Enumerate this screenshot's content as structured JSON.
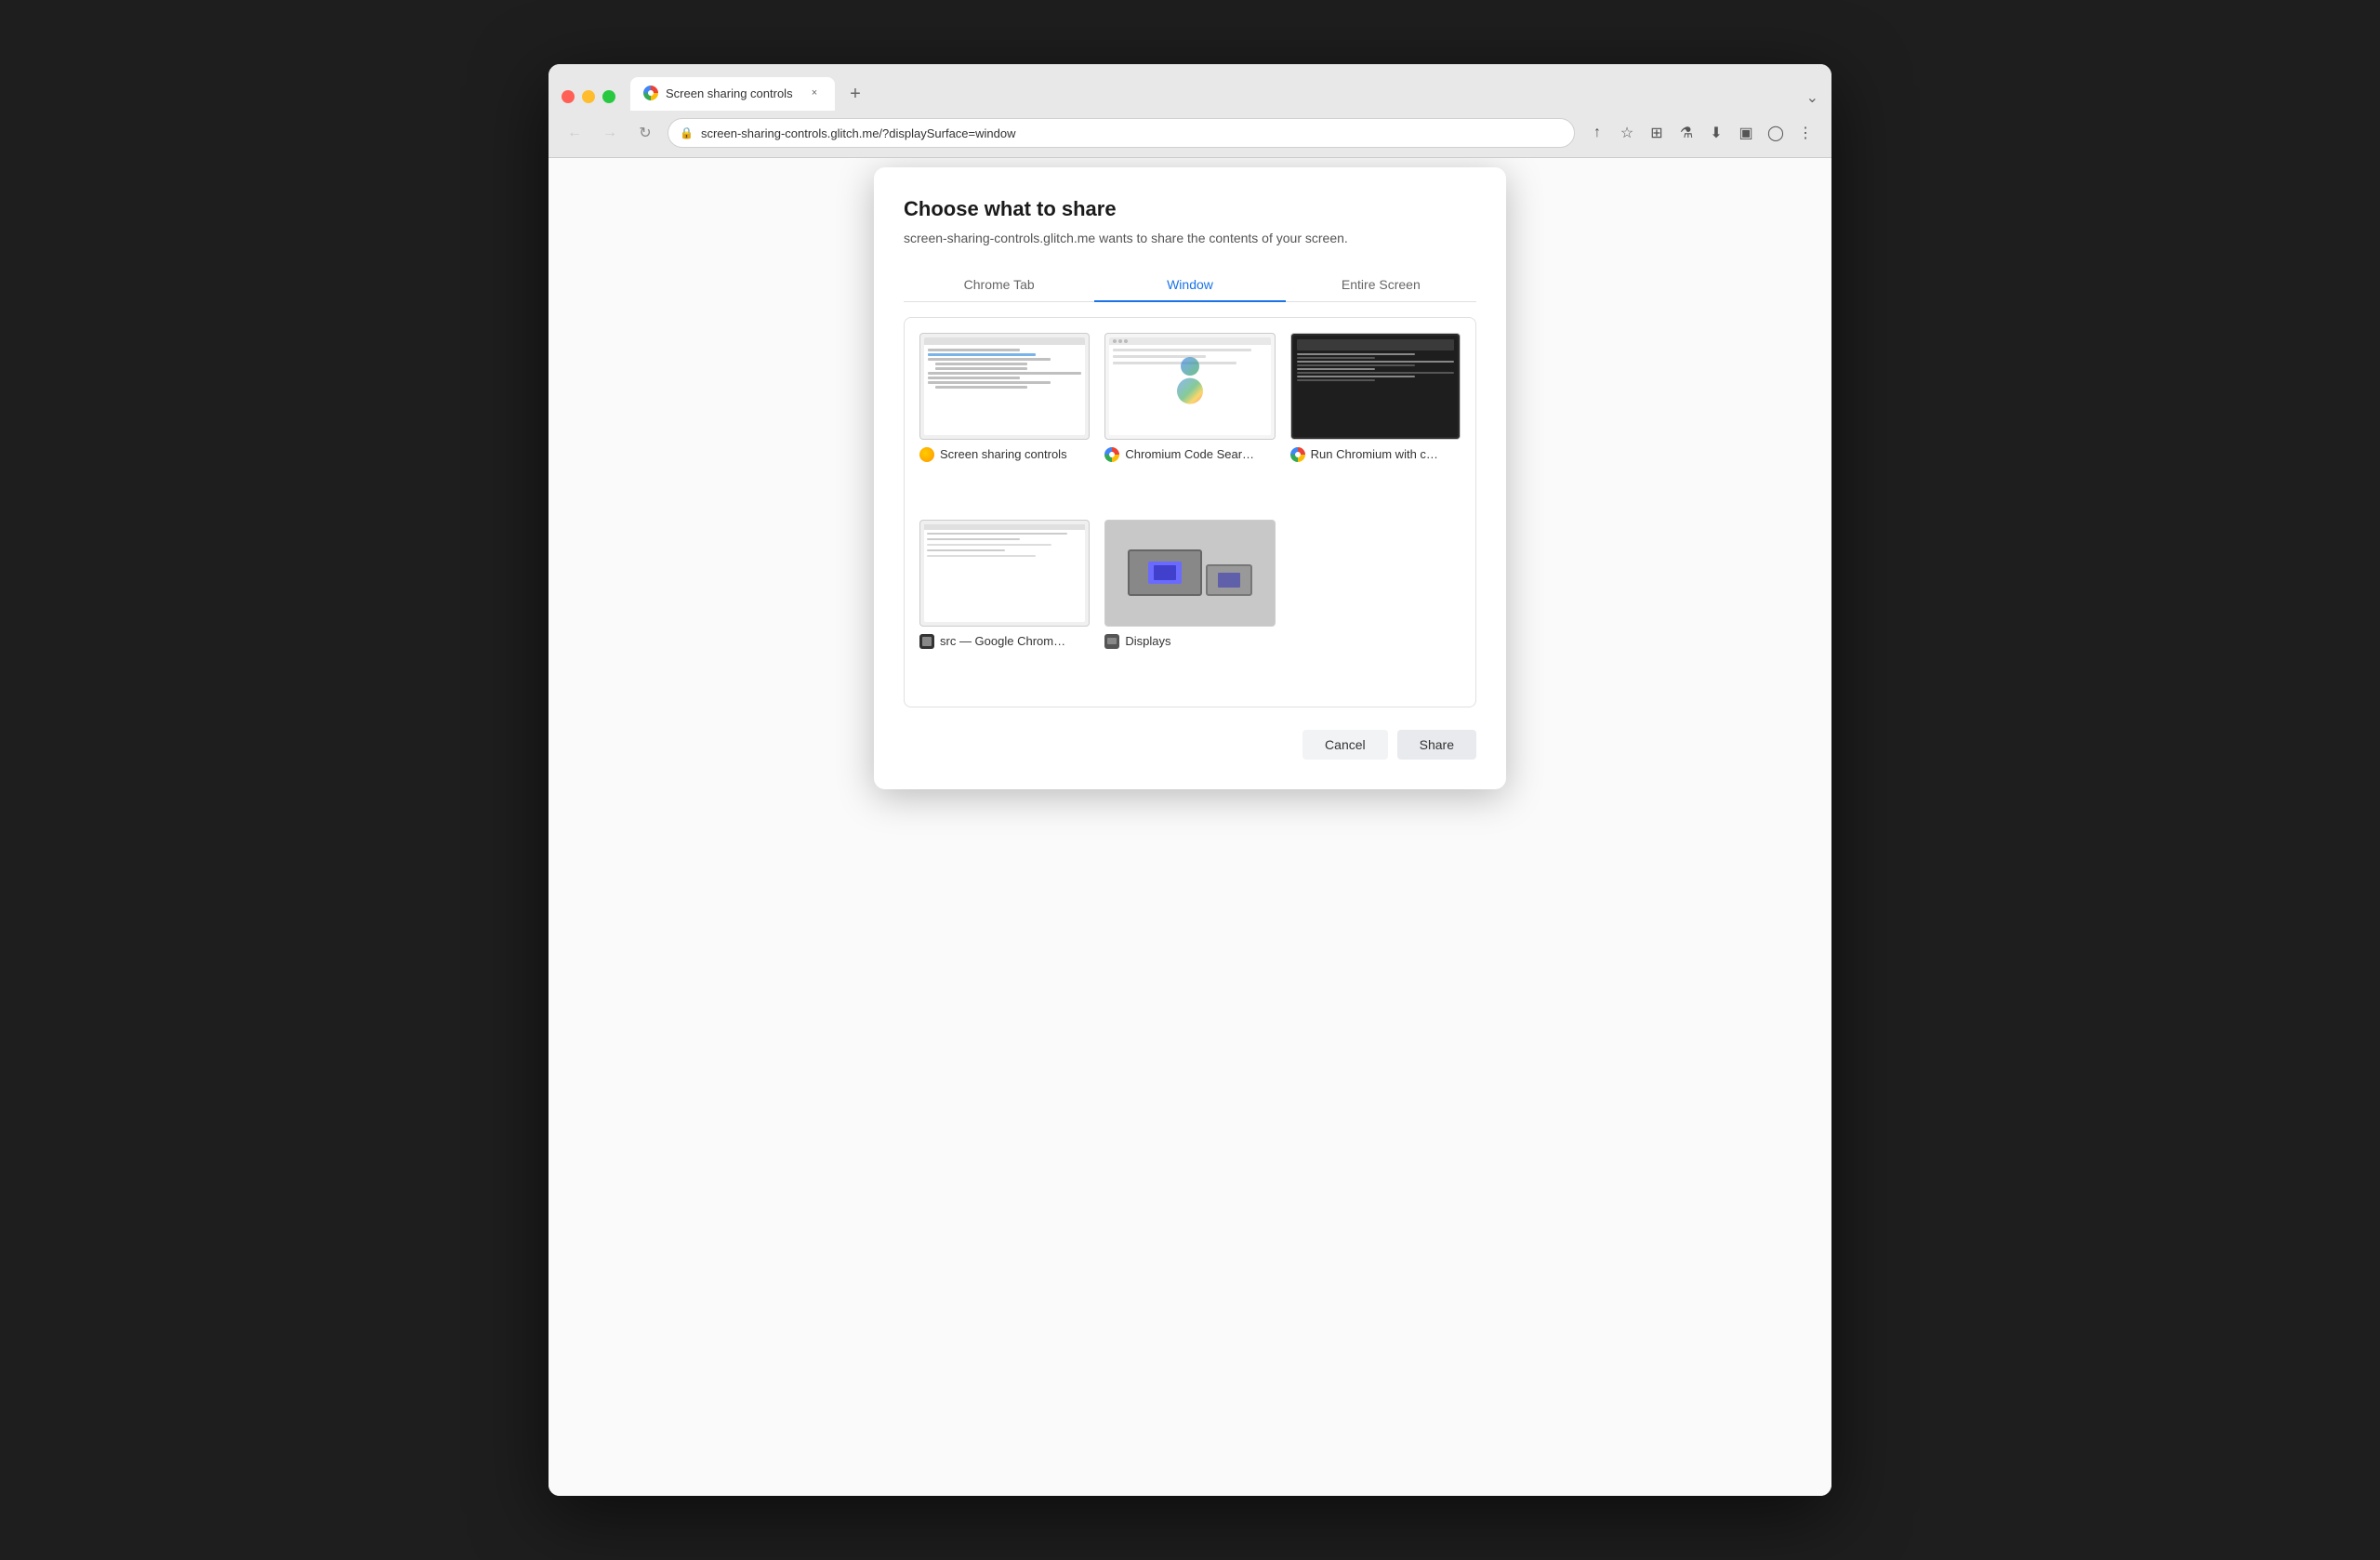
{
  "browser": {
    "tab_title": "Screen sharing controls",
    "tab_close": "×",
    "new_tab": "+",
    "dropdown": "⌄",
    "address": "screen-sharing-controls.glitch.me/?displaySurface=window"
  },
  "nav": {
    "back": "←",
    "forward": "→",
    "refresh": "↻"
  },
  "toolbar": {
    "share_icon": "↑",
    "star_icon": "☆",
    "puzzle_icon": "⊞",
    "flask_icon": "⚗",
    "download_icon": "⬇",
    "splitscreen_icon": "▣",
    "profile_icon": "◯",
    "menu_icon": "⋮"
  },
  "modal": {
    "title": "Choose what to share",
    "subtitle": "screen-sharing-controls.glitch.me wants to share the contents of your screen.",
    "tabs": [
      {
        "label": "Chrome Tab",
        "active": false
      },
      {
        "label": "Window",
        "active": true
      },
      {
        "label": "Entire Screen",
        "active": false
      }
    ],
    "windows": [
      {
        "id": "window-1",
        "label": "Screen sharing controls",
        "icon_type": "yellow"
      },
      {
        "id": "window-2",
        "label": "Chromium Code Searc…",
        "icon_type": "chrome"
      },
      {
        "id": "window-3",
        "label": "Run Chromium with co…",
        "icon_type": "chrome"
      },
      {
        "id": "window-4",
        "label": "src — Google Chrome...",
        "icon_type": "src"
      },
      {
        "id": "window-5",
        "label": "Displays",
        "icon_type": "displays"
      }
    ],
    "cancel_label": "Cancel",
    "share_label": "Share"
  }
}
